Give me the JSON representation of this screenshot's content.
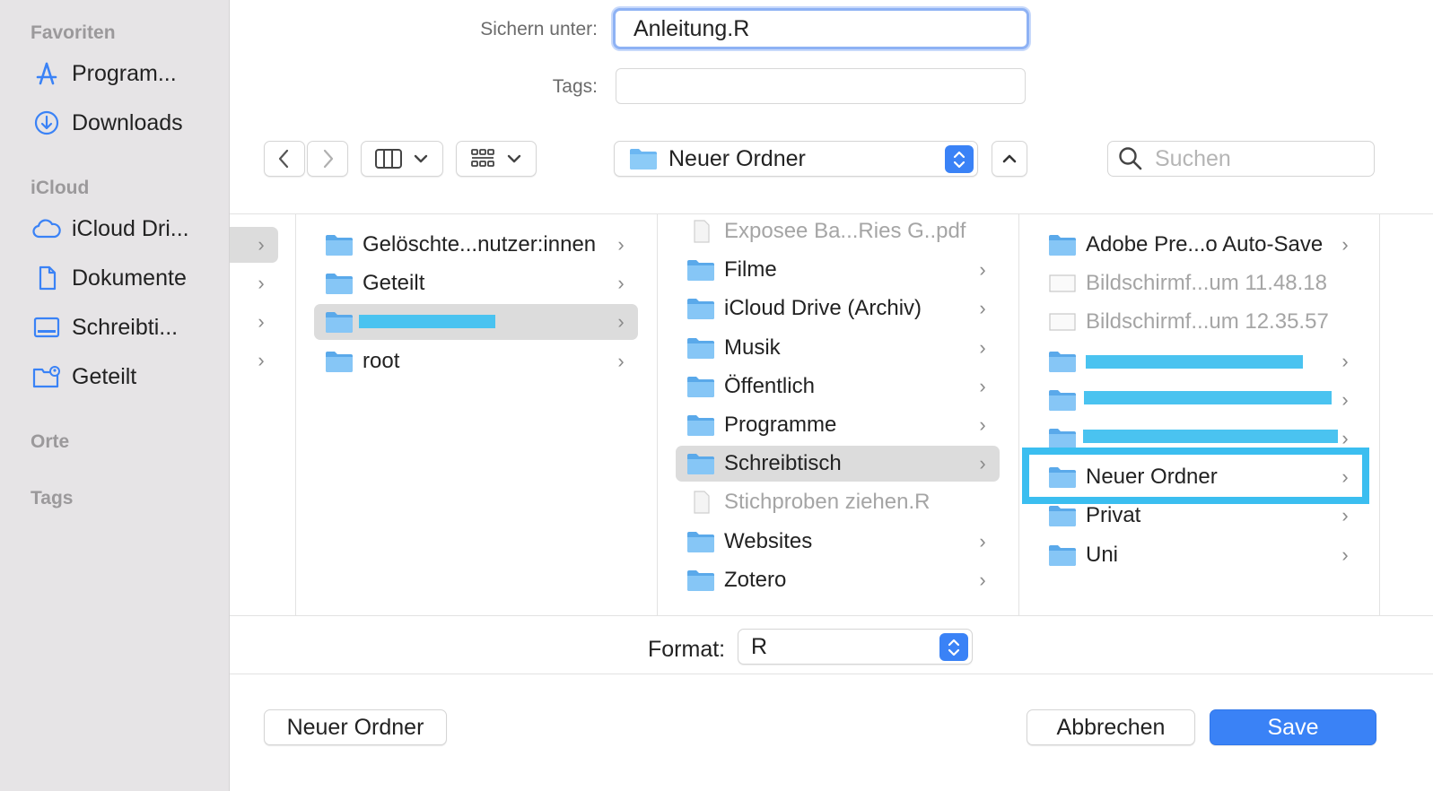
{
  "sidebar": {
    "favorites_header": "Favoriten",
    "icloud_header": "iCloud",
    "places_header": "Orte",
    "tags_header": "Tags",
    "favorites": [
      {
        "label": "Program...",
        "icon": "app-store-icon"
      },
      {
        "label": "Downloads",
        "icon": "download-circle-icon"
      }
    ],
    "icloud": [
      {
        "label": "iCloud Dri...",
        "icon": "cloud-icon"
      },
      {
        "label": "Dokumente",
        "icon": "document-icon"
      },
      {
        "label": "Schreibti...",
        "icon": "desktop-icon"
      },
      {
        "label": "Geteilt",
        "icon": "shared-folder-icon"
      }
    ]
  },
  "form": {
    "save_as_label": "Sichern unter:",
    "save_as_value": "Anleitung.R",
    "tags_label": "Tags:",
    "tags_value": ""
  },
  "toolbar": {
    "location": "Neuer Ordner",
    "search_placeholder": "Suchen"
  },
  "browser": {
    "column1": [
      {
        "name": "Gelöschte...nutzer:innen",
        "selected": false
      },
      {
        "name": "Geteilt",
        "selected": false
      },
      {
        "name": "",
        "selected": true,
        "redacted": true
      },
      {
        "name": "root",
        "selected": false
      }
    ],
    "column2": [
      {
        "name": "Exposee Ba...Ries G..pdf",
        "dim": true
      },
      {
        "name": "Filme"
      },
      {
        "name": "iCloud Drive (Archiv)"
      },
      {
        "name": "Musik"
      },
      {
        "name": "Öffentlich"
      },
      {
        "name": "Programme"
      },
      {
        "name": "Schreibtisch",
        "selected": true
      },
      {
        "name": "Stichproben ziehen.R",
        "dim": true
      },
      {
        "name": "Websites"
      },
      {
        "name": "Zotero"
      }
    ],
    "column3": [
      {
        "name": "Adobe Pre...o Auto-Save"
      },
      {
        "name": "Bildschirmf...um 11.48.18",
        "dim": true
      },
      {
        "name": "Bildschirmf...um 12.35.57",
        "dim": true
      },
      {
        "name": "",
        "redacted": true
      },
      {
        "name": "",
        "redacted": true
      },
      {
        "name": "",
        "redacted": true
      },
      {
        "name": "Neuer Ordner",
        "highlighted": true
      },
      {
        "name": "Privat"
      },
      {
        "name": "Uni"
      }
    ]
  },
  "format": {
    "label": "Format:",
    "value": "R"
  },
  "buttons": {
    "new_folder": "Neuer Ordner",
    "cancel": "Abbrechen",
    "save": "Save"
  },
  "colors": {
    "accent": "#3a82f6",
    "folder": "#6cb7f2",
    "annotation": "#3bbef0"
  }
}
